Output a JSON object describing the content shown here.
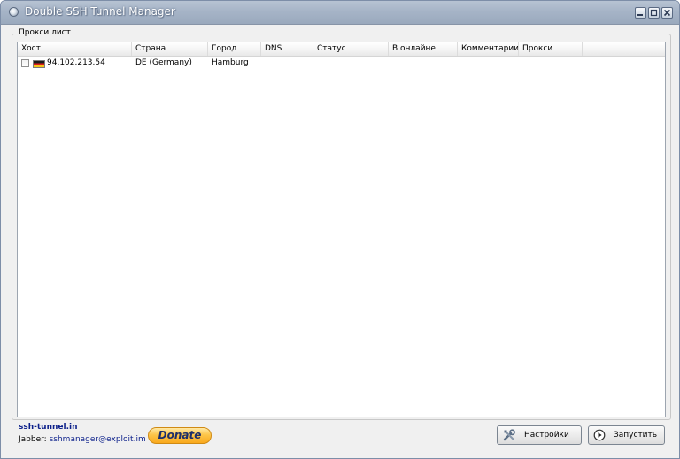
{
  "window": {
    "title": "Double SSH Tunnel Manager"
  },
  "group": {
    "label": "Прокси лист"
  },
  "table": {
    "columns": [
      "Хост",
      "Страна",
      "Город",
      "DNS",
      "Статус",
      "В онлайне",
      "Комментарии",
      "Прокси"
    ],
    "rows": [
      {
        "checked": false,
        "flag": "germany-flag-icon",
        "host": "94.102.213.54",
        "country": "DE (Germany)",
        "city": "Hamburg",
        "dns": "",
        "status": "",
        "online": "",
        "comment": "",
        "proxy": ""
      }
    ]
  },
  "footer": {
    "site": "ssh-tunnel.in",
    "jabber_label": "Jabber:",
    "jabber_contact": "sshmanager@exploit.im",
    "donate_label": "Donate",
    "settings_label": "Настройки",
    "start_label": "Запустить"
  },
  "icons": {
    "app": "app-icon",
    "minimize": "minimize-icon",
    "maximize": "maximize-icon",
    "close": "close-icon",
    "settings": "tools-icon",
    "start": "play-icon"
  },
  "colors": {
    "titlebar": "#a6b4c7",
    "link": "#0b1f8a",
    "donate": "#fdc64a"
  }
}
